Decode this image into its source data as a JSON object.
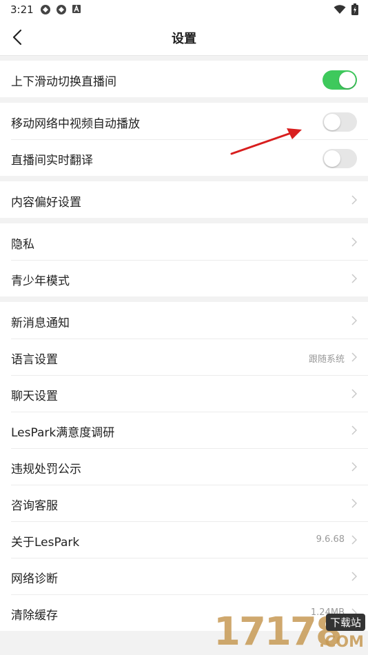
{
  "status_bar": {
    "time": "3:21",
    "left_icons": [
      "app-notification-icon",
      "app-notification-icon",
      "a-box-icon"
    ],
    "right_icons": [
      "wifi-icon",
      "battery-charging-icon"
    ]
  },
  "header": {
    "title": "设置",
    "back_icon": "chevron-left-icon"
  },
  "groups": [
    {
      "rows": [
        {
          "label": "上下滑动切换直播间",
          "type": "toggle",
          "on": true
        }
      ]
    },
    {
      "rows": [
        {
          "label": "移动网络中视频自动播放",
          "type": "toggle",
          "on": false
        },
        {
          "label": "直播间实时翻译",
          "type": "toggle",
          "on": false
        }
      ]
    },
    {
      "rows": [
        {
          "label": "内容偏好设置",
          "type": "link"
        }
      ]
    },
    {
      "rows": [
        {
          "label": "隐私",
          "type": "link"
        },
        {
          "label": "青少年模式",
          "type": "link"
        }
      ]
    },
    {
      "rows": [
        {
          "label": "新消息通知",
          "type": "link"
        },
        {
          "label": "语言设置",
          "type": "link",
          "value": "跟随系统"
        },
        {
          "label": "聊天设置",
          "type": "link"
        },
        {
          "label": "LesPark满意度调研",
          "type": "link"
        },
        {
          "label": "违规处罚公示",
          "type": "link"
        },
        {
          "label": "咨询客服",
          "type": "link"
        },
        {
          "label": "关于LesPark",
          "type": "link",
          "value": "9.6.68"
        },
        {
          "label": "网络诊断",
          "type": "link"
        },
        {
          "label": "清除缓存",
          "type": "link",
          "value": "1.24MB"
        }
      ]
    }
  ],
  "colors": {
    "toggle_on": "#3ec95c",
    "toggle_off": "#e6e6e6",
    "annotation_arrow": "#d81e1e",
    "watermark": "#c79a55"
  },
  "watermark": {
    "text": "17178",
    "badge": "下载站",
    "suffix": ".COM"
  }
}
